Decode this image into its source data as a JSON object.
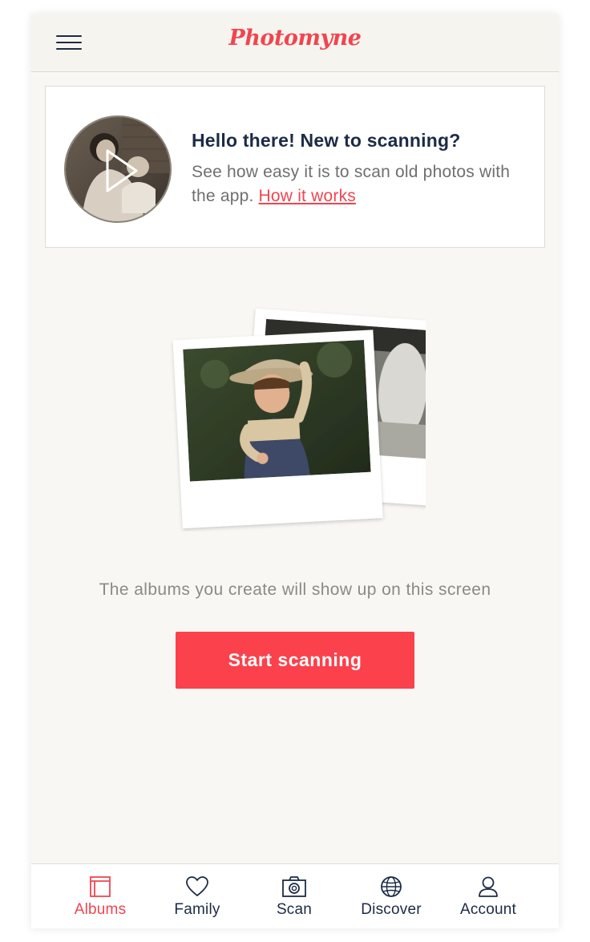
{
  "header": {
    "logo_text": "Photomyne",
    "menu_icon": "hamburger-menu-icon"
  },
  "intro_card": {
    "title": "Hello there! New to scanning?",
    "text": "See how easy it is to scan old photos with the app.",
    "link": "How it works",
    "thumbnail_icon": "play-icon"
  },
  "empty_state": {
    "message": "The albums you create will show up on this screen",
    "button_label": "Start scanning"
  },
  "tabbar": {
    "active": "Albums",
    "tabs": [
      {
        "label": "Albums",
        "icon": "albums-icon"
      },
      {
        "label": "Family",
        "icon": "heart-icon"
      },
      {
        "label": "Scan",
        "icon": "camera-icon"
      },
      {
        "label": "Discover",
        "icon": "globe-icon"
      },
      {
        "label": "Account",
        "icon": "person-icon"
      }
    ]
  },
  "colors": {
    "accent": "#f04550",
    "button": "#fb414b",
    "navy": "#1c2b45",
    "background": "#f8f7f3"
  }
}
